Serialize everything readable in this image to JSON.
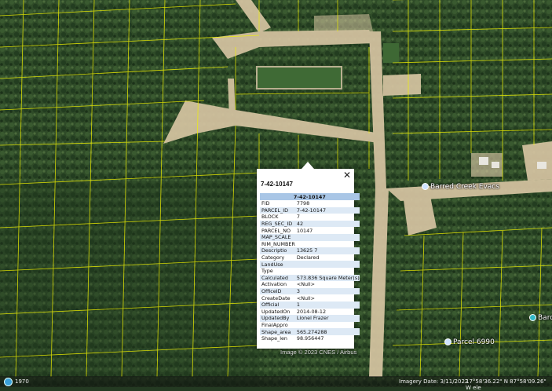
{
  "map": {
    "colors": {
      "vegetation": "#2d4a27",
      "road": "#d9c8a8",
      "parcel_line": "#ffff00"
    },
    "labels": {
      "street_name": "Barred Creek Evacs",
      "place_label": "Parcel 6990",
      "right_label": "Barda"
    },
    "copyright": "Image © 2023 CNES / Airbus"
  },
  "popup": {
    "title": "7-42-10147",
    "close_icon": "close-icon",
    "table_header": "7-42-10147",
    "rows": [
      {
        "key": "FID",
        "value": "7798"
      },
      {
        "key": "PARCEL_ID",
        "value": "7-42-10147"
      },
      {
        "key": "BLOCK",
        "value": "7"
      },
      {
        "key": "REG_SEC_ID",
        "value": "42"
      },
      {
        "key": "PARCEL_NO",
        "value": "10147"
      },
      {
        "key": "MAP_SCALE",
        "value": ""
      },
      {
        "key": "RIM_NUMBER",
        "value": ""
      },
      {
        "key": "Descriptio",
        "value": "13625 7"
      },
      {
        "key": "Category",
        "value": "Declared"
      },
      {
        "key": "LandUse",
        "value": ""
      },
      {
        "key": "Type",
        "value": ""
      },
      {
        "key": "Calculated",
        "value": "573.836 Square Meter(s)"
      },
      {
        "key": "Activation",
        "value": "<Null>"
      },
      {
        "key": "OfficeID",
        "value": "3"
      },
      {
        "key": "CreateDate",
        "value": "<Null>"
      },
      {
        "key": "Official",
        "value": "1"
      },
      {
        "key": "UpdatedOn",
        "value": "2014-08-12"
      },
      {
        "key": "UpdatedBy",
        "value": "Lionel Frazer"
      },
      {
        "key": "FinalAppro",
        "value": ""
      },
      {
        "key": "Shape_area",
        "value": "565.274288"
      },
      {
        "key": "Shape_len",
        "value": "98.956447"
      }
    ]
  },
  "statusbar": {
    "year": "1970",
    "imagery_date": "Imagery Date: 3/11/2022",
    "coords": "17°58'36.22\" N  87°58'09.26\" W  ele"
  }
}
